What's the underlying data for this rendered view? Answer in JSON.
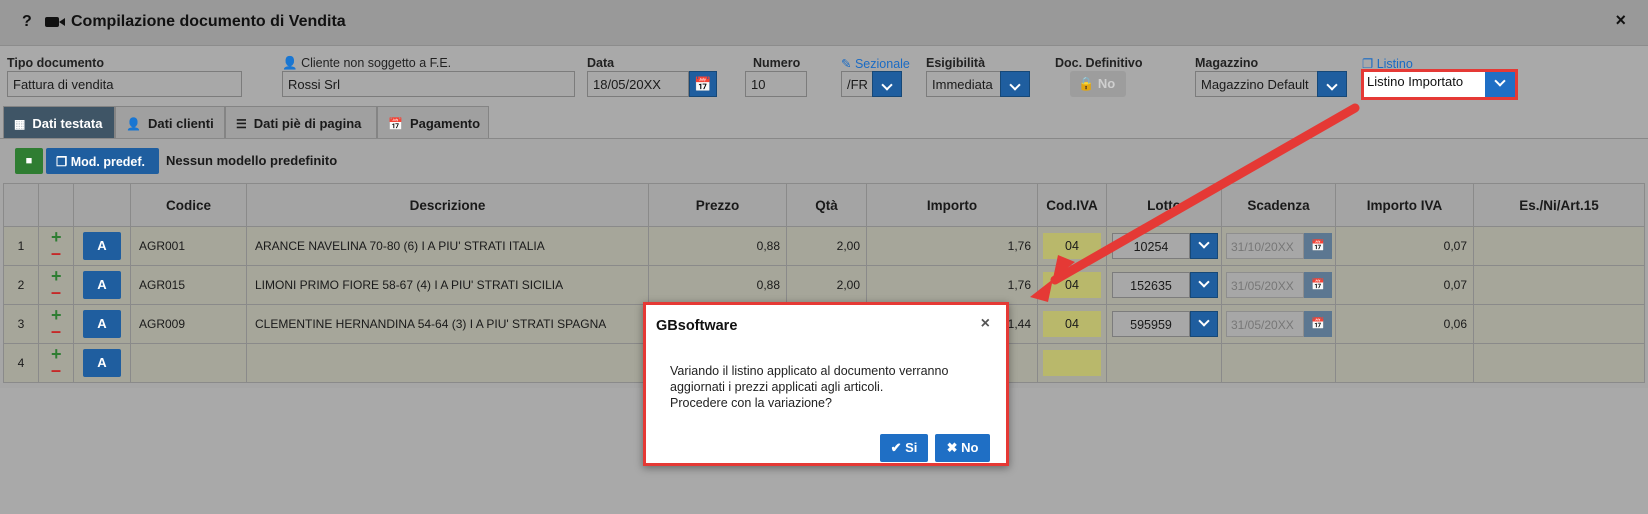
{
  "window": {
    "help": "?",
    "title": "Compilazione documento di Vendita",
    "close": "×"
  },
  "header": {
    "tipo_documento": {
      "label": "Tipo documento",
      "value": "Fattura di vendita"
    },
    "cliente": {
      "label": "Cliente non soggetto a F.E.",
      "value": "Rossi Srl"
    },
    "data": {
      "label": "Data",
      "value": "18/05/20XX"
    },
    "numero": {
      "label": "Numero",
      "value": "10"
    },
    "sezionale": {
      "label": "Sezionale",
      "value": "/FR"
    },
    "esigibilita": {
      "label": "Esigibilità",
      "value": "Immediata"
    },
    "doc_definitivo": {
      "label": "Doc. Definitivo",
      "value": "No"
    },
    "magazzino": {
      "label": "Magazzino",
      "value": "Magazzino Default"
    },
    "listino": {
      "label": "Listino",
      "value": "Listino Importato"
    }
  },
  "tabs": [
    {
      "label": "Dati testata",
      "active": true
    },
    {
      "label": "Dati clienti"
    },
    {
      "label": "Dati piè di pagina"
    },
    {
      "label": "Pagamento"
    }
  ],
  "toolbar": {
    "mod_label": "Mod. predef.",
    "model_text": "Nessun modello predefinito"
  },
  "table": {
    "columns": [
      "Codice",
      "Descrizione",
      "Prezzo",
      "Qtà",
      "Importo",
      "Cod.IVA",
      "Lotto",
      "Scadenza",
      "Importo IVA",
      "Es./Ni/Art.15"
    ],
    "a_label": "A",
    "rows": [
      {
        "n": "1",
        "codice": "AGR001",
        "descrizione": "ARANCE NAVELINA 70-80 (6) I A PIU' STRATI     ITALIA",
        "prezzo": "0,88",
        "qta": "2,00",
        "importo": "1,76",
        "iva": "04",
        "lotto": "10254",
        "scadenza": "31/10/20XX",
        "importo_iva": "0,07"
      },
      {
        "n": "2",
        "codice": "AGR015",
        "descrizione": "LIMONI PRIMO FIORE 58-67 (4) I A PIU' STRATI     SICILIA",
        "prezzo": "0,88",
        "qta": "2,00",
        "importo": "1,76",
        "iva": "04",
        "lotto": "152635",
        "scadenza": "31/05/20XX",
        "importo_iva": "0,07"
      },
      {
        "n": "3",
        "codice": "AGR009",
        "descrizione": "CLEMENTINE HERNANDINA 54-64 (3) I A PIU' STRATI     SPAGNA",
        "prezzo": "",
        "qta": "",
        "importo": "1,44",
        "iva": "04",
        "lotto": "595959",
        "scadenza": "31/05/20XX",
        "importo_iva": "0,06"
      },
      {
        "n": "4",
        "codice": "",
        "descrizione": "",
        "prezzo": "",
        "qta": "",
        "importo": "",
        "iva": "",
        "lotto": "",
        "scadenza": "",
        "importo_iva": ""
      }
    ]
  },
  "dialog": {
    "title": "GBsoftware",
    "close": "×",
    "line1": "Variando il listino applicato al documento verranno",
    "line2": "aggiornati i prezzi applicati agli articoli.",
    "line3": "Procedere con la variazione?",
    "yes": "✔ Si",
    "no": "✖ No"
  },
  "colors": {
    "accent": "#1f5e9f",
    "highlight": "#e53935",
    "save": "#2f7d32"
  }
}
